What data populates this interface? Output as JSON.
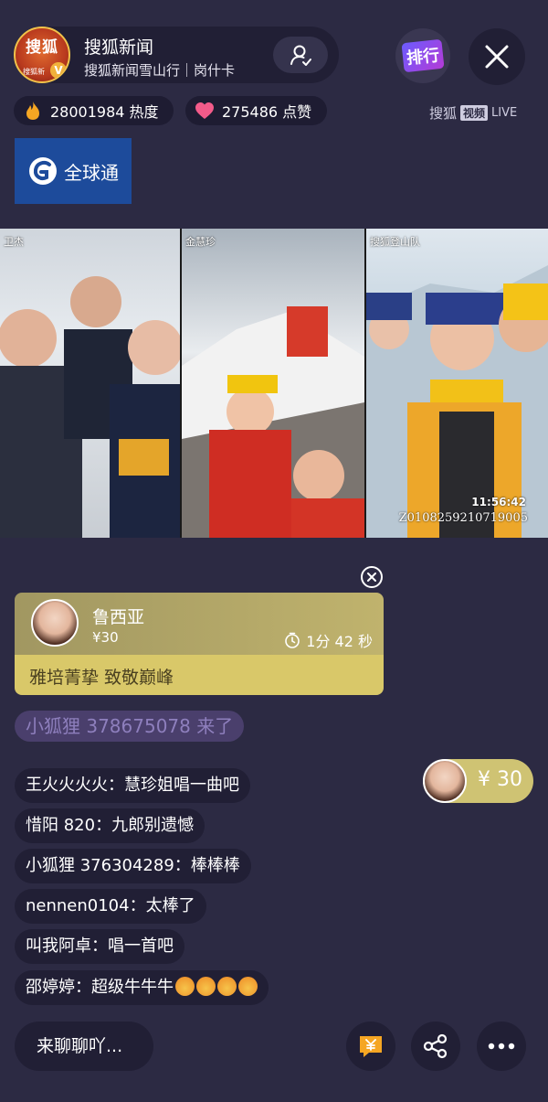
{
  "header": {
    "host_name": "搜狐新闻",
    "host_subtitle": "搜狐新闻雪山行｜岗什卡",
    "avatar_logo_text": "搜狐",
    "avatar_sub_text": "搜狐新",
    "avatar_badge": "V",
    "rank_label": "排行"
  },
  "stats": {
    "heat": "28001984 热度",
    "likes": "275486 点赞"
  },
  "brand": {
    "name": "搜狐",
    "tag": "视频",
    "live": "LIVE"
  },
  "sponsor": {
    "name": "全球通"
  },
  "video": {
    "panes": [
      {
        "label": "卫杰"
      },
      {
        "label": "金慧珍"
      },
      {
        "label": "搜狐登山队"
      }
    ],
    "time": "11:56:42",
    "id": "Z010825921071900​5"
  },
  "gift": {
    "sender": "鲁西亚",
    "amount": "¥30",
    "timer": "1分 42 秒",
    "message": "雅培菁挚 致敬巅峰"
  },
  "join_notice": "小狐狸 378675078 来了",
  "chat": [
    {
      "text": "王火火火火：慧珍姐唱一曲吧"
    },
    {
      "text": "惜阳 820：九郎别遗憾"
    },
    {
      "text": "小狐狸 376304289：棒棒棒"
    },
    {
      "text": "nennen0104：太棒了"
    },
    {
      "text": "叫我阿卓：唱一首吧"
    },
    {
      "text": "邵婷婷：超级牛牛牛"
    }
  ],
  "tip": {
    "amount": "¥ 30"
  },
  "bottom": {
    "input_placeholder": "来聊聊吖..."
  },
  "colors": {
    "background": "#2c2a43",
    "pill": "#211f35",
    "gift_top": "#a19761",
    "gift_bottom": "#d9c869",
    "accent_orange": "#f5a623",
    "heart_pink": "#f35b8a"
  }
}
